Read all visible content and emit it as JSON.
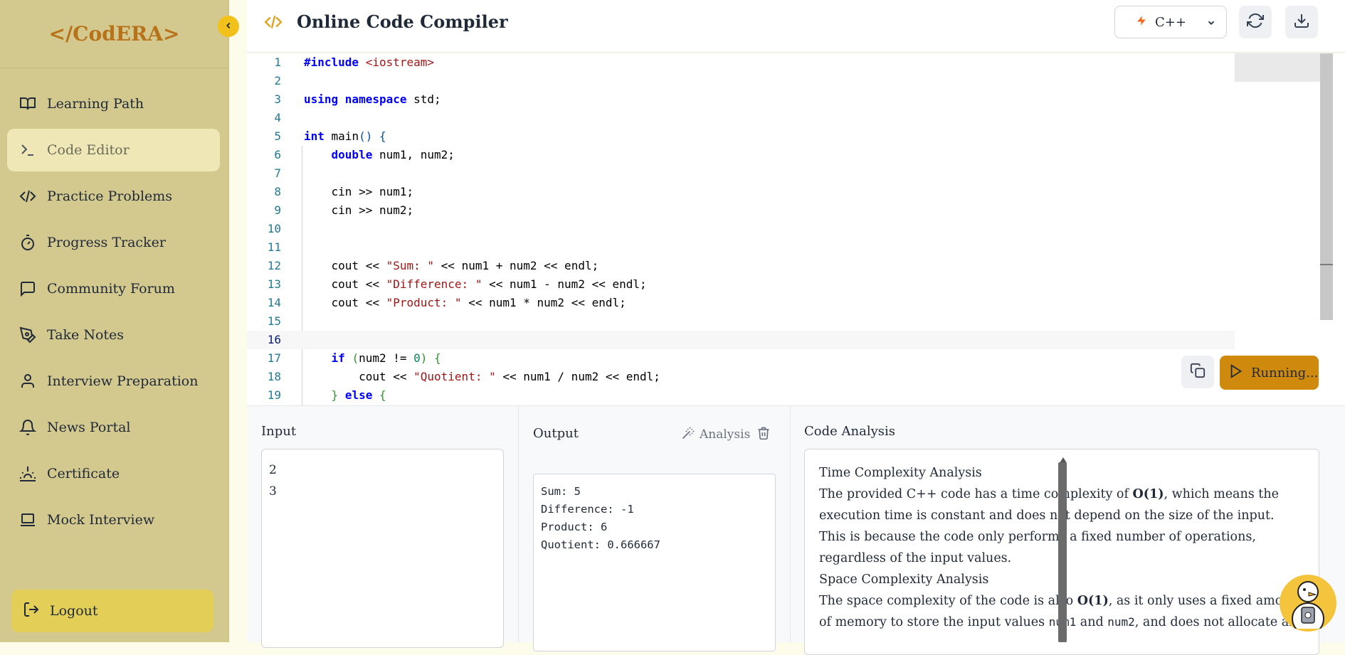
{
  "brand": "</CodERA>",
  "sidebar": {
    "items": [
      {
        "label": "Learning Path",
        "icon": "book-open-icon"
      },
      {
        "label": "Code Editor",
        "icon": "terminal-icon"
      },
      {
        "label": "Practice Problems",
        "icon": "code-icon"
      },
      {
        "label": "Progress Tracker",
        "icon": "timer-icon"
      },
      {
        "label": "Community Forum",
        "icon": "message-square-icon"
      },
      {
        "label": "Take Notes",
        "icon": "pen-tool-icon"
      },
      {
        "label": "Interview Preparation",
        "icon": "user-icon"
      },
      {
        "label": "News Portal",
        "icon": "bell-icon"
      },
      {
        "label": "Certificate",
        "icon": "sunrise-icon"
      },
      {
        "label": "Mock Interview",
        "icon": "laptop-icon"
      }
    ],
    "active_index": 1,
    "logout_label": "Logout"
  },
  "header": {
    "title": "Online Code Compiler",
    "language": "C++"
  },
  "editor": {
    "run_label": "Running...",
    "current_line": 16
  },
  "panels": {
    "input_title": "Input",
    "input_lines": [
      "2",
      "3"
    ],
    "output_title": "Output",
    "analysis_button": "Analysis",
    "output_lines": [
      "Sum: 5",
      "Difference: -1",
      "Product: 6",
      "Quotient: 0.666667"
    ],
    "code_analysis_title": "Code Analysis",
    "analysis": {
      "time_heading": "Time Complexity Analysis",
      "time_text_1": "The provided C++ code has a time complexity of ",
      "time_bold": "O(1)",
      "time_text_2": ", which means the execution time is constant and does not depend on the size of the input. This is because the code only performs a fixed number of operations, regardless of the input values.",
      "space_heading": "Space Complexity Analysis",
      "space_text_1": "The space complexity of the code is also ",
      "space_bold": "O(1)",
      "space_text_2": ", as it only uses a fixed amount of memory to store the input values ",
      "space_var1": "num1",
      "space_and": " and ",
      "space_var2": "num2",
      "space_text_3": ", and does not allocate any"
    }
  },
  "colors": {
    "sidebar_bg": "#d3c98f",
    "brand": "#b8731a",
    "accent": "#f2c21b",
    "run_button": "#cf8a0e",
    "logout_bg": "#e3cf58"
  }
}
